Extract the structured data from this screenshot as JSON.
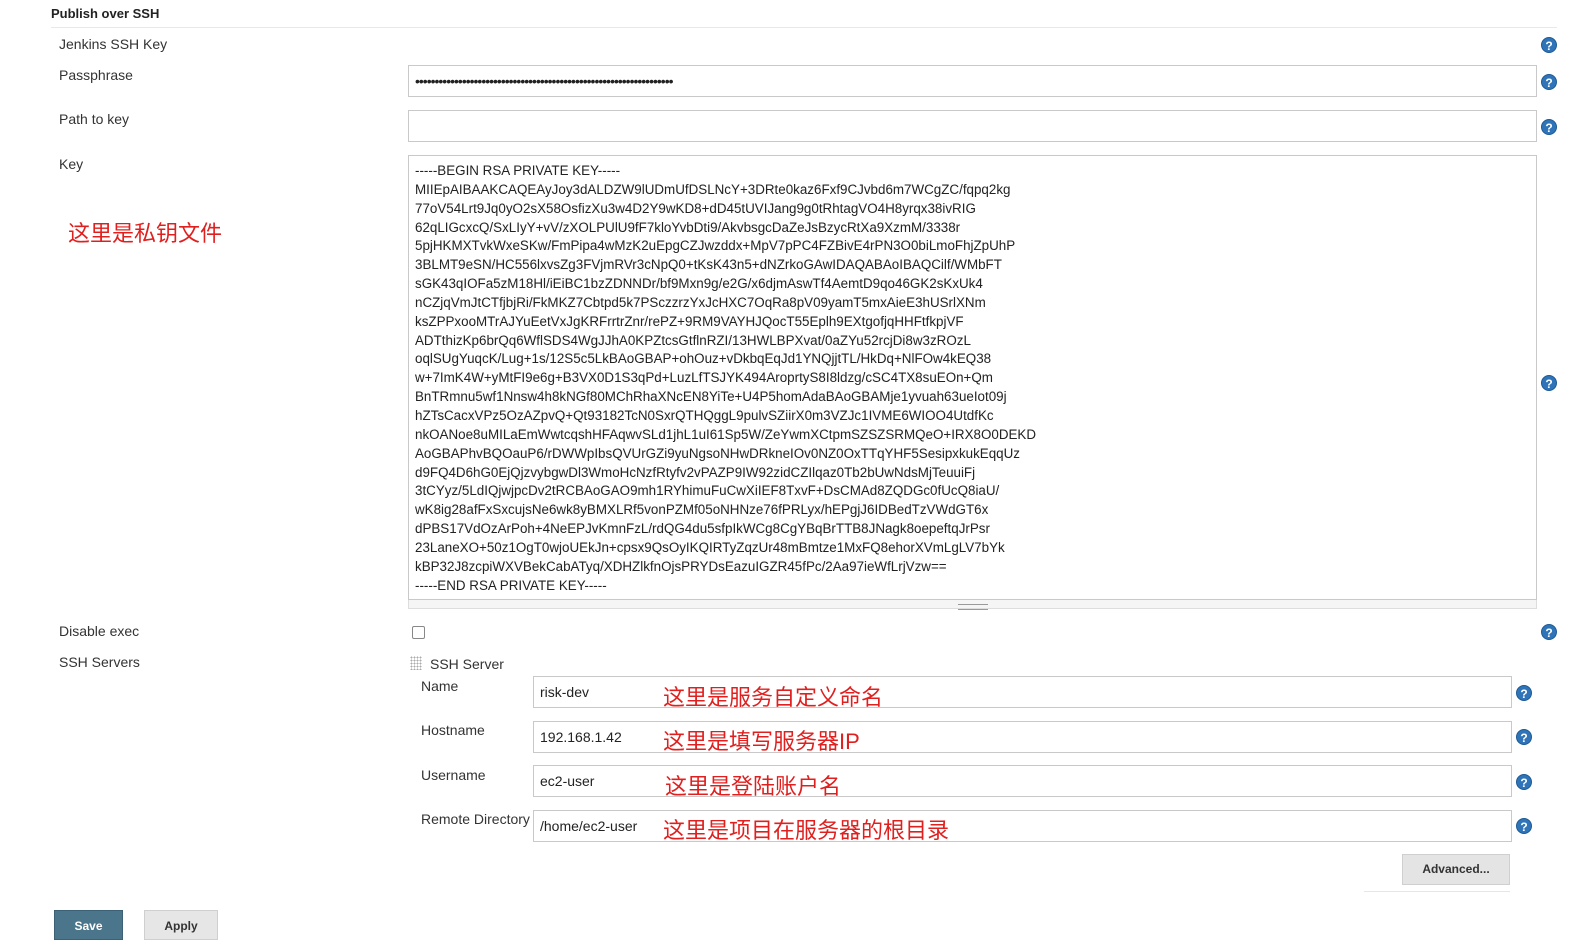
{
  "section": {
    "title": "Publish over SSH"
  },
  "fields": {
    "jenkins_ssh_key": {
      "label": "Jenkins SSH Key"
    },
    "passphrase": {
      "label": "Passphrase",
      "value": "••••••••••••••••••••••••••••••••••••••••••••••••••••••••••••••••••"
    },
    "path_to_key": {
      "label": "Path to key",
      "value": ""
    },
    "key": {
      "label": "Key",
      "value": "-----BEGIN RSA PRIVATE KEY-----\nMIIEpAIBAAKCAQEAyJoy3dALDZW9lUDmUfDSLNcY+3DRte0kaz6Fxf9CJvbd6m7WCgZC/fqpq2kg\n77oV54Lrt9Jq0yO2sX58OsfizXu3w4D2Y9wKD8+dD45tUVIJang9g0tRhtagVO4H8yrqx38ivRIG\n62qLIGcxcQ/SxLIyY+vV/zXOLPUlU9fF7kloYvbDti9/AkvbsgcDaZeJsBzycRtXa9XzmM/3338r\n5pjHKMXTvkWxeSKw/FmPipa4wMzK2uEpgCZJwzddx+MpV7pPC4FZBivE4rPN3O0biLmoFhjZpUhP\n3BLMT9eSN/HC556lxvsZg3FVjmRVr3cNpQ0+tKsK43n5+dNZrkoGAwIDAQABAoIBAQCilf/WMbFT\nsGK43qIOFa5zM18Hl/iEiBC1bzZDNNDr/bf9Mxn9g/e2G/x6djmAswTf4AemtD9qo46GK2sKxUk4\nnCZjqVmJtCTfjbjRi/FkMKZ7Cbtpd5k7PSczzrzYxJcHXC7OqRa8pV09yamT5mxAieE3hUSrlXNm\nksZPPxooMTrAJYuEetVxJgKRFrrtrZnr/rePZ+9RM9VAYHJQocT55Eplh9EXtgofjqHHFtfkpjVF\nADTthizKp6brQq6WflSDS4WgJJhA0KPZtcsGtflnRZI/13HWLBPXvat/0aZYu52rcjDi8w3zROzL\noqlSUgYuqcK/Lug+1s/12S5c5LkBAoGBAP+ohOuz+vDkbqEqJd1YNQjjtTL/HkDq+NlFOw4kEQ38\nw+7ImK4W+yMtFI9e6g+B3VX0D1S3qPd+LuzLfTSJYK494AroprtyS8I8ldzg/cSC4TX8suEOn+Qm\nBnTRmnu5wf1Nnsw4h8kNGf80MChRhaXNcEN8YiTe+U4P5homAdaBAoGBAMje1yvuah63ueIot09j\nhZTsCacxVPz5OzAZpvQ+Qt93182TcN0SxrQTHQggL9pulvSZiirX0m3VZJc1IVME6WIOO4UtdfKc\nnkOANoe8uMILaEmWwtcqshHFAqwvSLd1jhL1uI61Sp5W/ZeYwmXCtpmSZSZSRMQeO+IRX8O0DEKD\nAoGBAPhvBQOauP6/rDWWpIbsQVUrGZi9yuNgsoNHwDRkneIOv0NZ0OxTTqYHF5SesipxkukEqqUz\nd9FQ4D6hG0EjQjzvybgwDl3WmoHcNzfRtyfv2vPAZP9IW92zidCZIlqaz0Tb2bUwNdsMjTeuuiFj\n3tCYyz/5LdIQjwjpcDv2tRCBAoGAO9mh1RYhimuFuCwXiIEF8TxvF+DsCMAd8ZQDGc0fUcQ8iaU/\nwK8ig28afFxSxcujsNe6wk8yBMXLRf5vonPZMf05oNHNze76fPRLyx/hEPgjJ6IDBedTzVWdGT6x\ndPBS17VdOzArPoh+4NeEPJvKmnFzL/rdQG4du5sfpIkWCg8CgYBqBrTTB8JNagk8oepeftqJrPsr\n23LaneXO+50z1OgT0wjoUEkJn+cpsx9QsOyIKQIRTyZqzUr48mBmtze1MxFQ8ehorXVmLgLV7bYk\nkBP32J8zcpiWXVBekCabATyq/XDHZlkfnOjsPRYDsEazuIGZR45fPc/2Aa97ieWfLrjVzw==\n-----END RSA PRIVATE KEY-----"
    },
    "disable_exec": {
      "label": "Disable exec",
      "checked": false
    },
    "ssh_servers": {
      "label": "SSH Servers"
    }
  },
  "ssh_server": {
    "header": "SSH Server",
    "name": {
      "label": "Name",
      "value": "risk-dev"
    },
    "hostname": {
      "label": "Hostname",
      "value": "192.168.1.42"
    },
    "username": {
      "label": "Username",
      "value": "ec2-user"
    },
    "remote_directory": {
      "label": "Remote Directory",
      "value": "/home/ec2-user"
    },
    "advanced_label": "Advanced..."
  },
  "annotations": {
    "key_note": "这里是私钥文件",
    "name_note": "这里是服务自定义命名",
    "hostname_note": "这里是填写服务器IP",
    "username_note": "这里是登陆账户名",
    "remote_dir_note": "这里是项目在服务器的根目录"
  },
  "help_icon_glyph": "?",
  "buttons": {
    "save": "Save",
    "apply": "Apply"
  },
  "colors": {
    "accent": "#2f74b8",
    "annotation_red": "#e0201f",
    "save_button": "#4b758b"
  }
}
